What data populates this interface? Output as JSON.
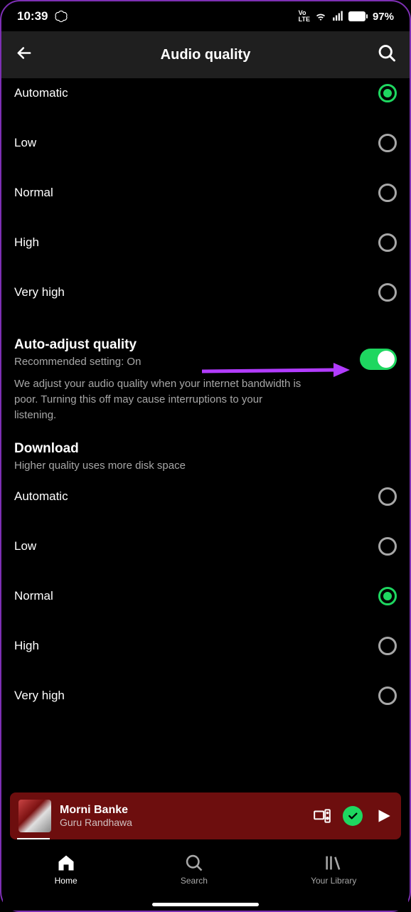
{
  "status": {
    "time": "10:39",
    "battery": "97%",
    "volte": "VoLTE"
  },
  "header": {
    "title": "Audio quality"
  },
  "streaming_options": [
    {
      "label": "Automatic",
      "selected": true
    },
    {
      "label": "Low",
      "selected": false
    },
    {
      "label": "Normal",
      "selected": false
    },
    {
      "label": "High",
      "selected": false
    },
    {
      "label": "Very high",
      "selected": false
    }
  ],
  "auto_adjust": {
    "heading": "Auto-adjust quality",
    "sub": "Recommended setting: On",
    "desc": "We adjust your audio quality when your internet bandwidth is poor. Turning this off may cause interruptions to your listening.",
    "enabled": true
  },
  "download": {
    "heading": "Download",
    "sub": "Higher quality uses more disk space",
    "options": [
      {
        "label": "Automatic",
        "selected": false
      },
      {
        "label": "Low",
        "selected": false
      },
      {
        "label": "Normal",
        "selected": true
      },
      {
        "label": "High",
        "selected": false
      },
      {
        "label": "Very high",
        "selected": false
      }
    ]
  },
  "now_playing": {
    "title": "Morni Banke",
    "artist": "Guru Randhawa"
  },
  "nav": {
    "home": "Home",
    "search": "Search",
    "library": "Your Library"
  }
}
